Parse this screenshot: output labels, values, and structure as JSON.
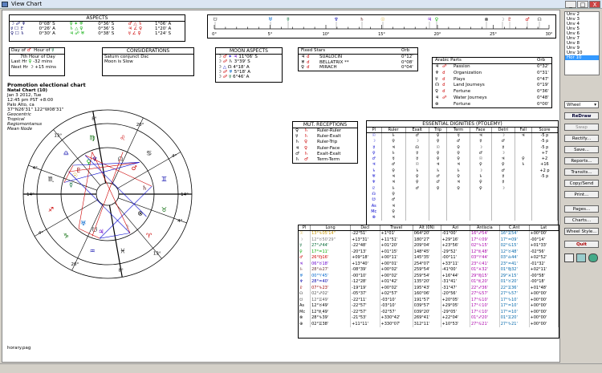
{
  "window": {
    "title": "View Chart",
    "min": "_",
    "max": "□",
    "close": "X"
  },
  "aspects": {
    "title": "ASPECTS",
    "rows": [
      [
        "☽ ☍ ♆",
        "0°08' S",
        "♀ ✶ ♅",
        "0°36' S",
        "♂ △ ♄",
        "1°06' A"
      ],
      [
        "☿ ☐ ♇",
        "0°26' A",
        "♄ △ ♀",
        "0°36' S",
        "♃ ∠ ♀",
        "1°20' A"
      ],
      [
        "♀ ☐ ♄",
        "0°30' A",
        "♃ ☍ ♅",
        "0°38' S",
        "☿ ∠ ♀",
        "1°24' S"
      ]
    ]
  },
  "day_hour": {
    "day_label": "Day of",
    "day_glyph": "♂",
    "hour_label": "Hour of",
    "hour_glyph": "☿",
    "line2": "7th Hour of Day",
    "last_label": "Last Hr",
    "last_glyph": "♀",
    "last_val": "-32 mins",
    "next_label": "Next Hr",
    "next_glyph": "☽",
    "next_val": "+15 mins"
  },
  "considerations": {
    "title": "CONSIDERATIONS",
    "lines": [
      "Saturn conjunct Dsc",
      "Moon is Slow"
    ]
  },
  "moon_aspects": {
    "title": "MOON ASPECTS",
    "rows": [
      [
        "☽",
        "♂",
        "✶",
        "♃",
        "11°06' S"
      ],
      [
        "☽",
        "☍",
        "♄",
        "3°39' S"
      ],
      [
        "☽",
        "△",
        "☊",
        "4°18' A"
      ],
      [
        "☽",
        "☍",
        "♅",
        "5°18' A"
      ],
      [
        "☽",
        "☍",
        "☿",
        "6°46' A"
      ]
    ]
  },
  "fixed_stars": {
    "title": "Fixed Stars",
    "orb": "Orb",
    "rows": [
      [
        "♃",
        "☌",
        "SUALOCIN",
        "0°12'"
      ],
      [
        "♅",
        "☌",
        "BELLATRIX **",
        "0°08'"
      ],
      [
        "♀",
        "☌",
        "MIRACH",
        "0°04'"
      ]
    ]
  },
  "arabic_parts": {
    "title": "Arabic Parts",
    "orb": "Orb",
    "rows": [
      [
        "♃",
        "☍",
        "Passion",
        "0°32'"
      ],
      [
        "♆",
        "☌",
        "Organization",
        "0°31'"
      ],
      [
        "☿",
        "☌",
        "Plays",
        "0°47'"
      ],
      [
        "☊",
        "☌",
        "Land Journeys",
        "0°19'"
      ],
      [
        "♀",
        "☌",
        "Fortune",
        "0°36'"
      ],
      [
        "♃",
        "☍",
        "Water Journeys",
        "0°48'"
      ],
      [
        "⊗",
        "",
        "Fortune",
        "0°00'"
      ]
    ]
  },
  "chart_info": {
    "title": "Promotion electional chart",
    "name": "Natal Chart (10)",
    "date": "Jan 3 2012, Tue",
    "time": "12:45 pm  PST +8:00",
    "place": "Palo Alto, ca",
    "coords": "37°N26'31\" 122°W08'31\"",
    "z1": "Geocentric",
    "z2": "Tropical",
    "z3": "Regiomontanus",
    "z4": "Mean Node",
    "file": "horary.pag"
  },
  "wheel": {
    "cusps": [
      "14°",
      "4°",
      "20°",
      "8°",
      "13°",
      "4°",
      "14°",
      "4°",
      "20°",
      "8°",
      "13°",
      "4°"
    ],
    "signs": [
      "♐",
      "♑",
      "♒",
      "♓",
      "♈",
      "♉",
      "♊",
      "♋",
      "♌",
      "♍",
      "♎",
      "♏"
    ]
  },
  "receptions": {
    "title": "MUT. RECEPTIONS",
    "rows": [
      [
        "♀",
        "♄",
        "Ruler-Ruler"
      ],
      [
        "☿",
        "♄",
        "Ruler-Exalt"
      ],
      [
        "♄",
        "♀",
        "Ruler-Trip"
      ],
      [
        "♃",
        "♀",
        "Ruler-Face"
      ],
      [
        "♂",
        "♄",
        "Exalt-Exalt"
      ],
      [
        "♄",
        "♂",
        "Term-Term"
      ]
    ]
  },
  "dignities": {
    "title": "ESSENTIAL DIGNITIES (PTOLEMY)",
    "headers": [
      "Pl",
      "Ruler",
      "Exalt",
      "Trip",
      "Term",
      "Face",
      "Detri",
      "Fall",
      "Score"
    ],
    "rows": [
      [
        "☉",
        "♄",
        "♂",
        "♀",
        "☿",
        "♃",
        "☽",
        "♃",
        "-5 p"
      ],
      [
        "☽",
        "♀",
        "☽",
        "♀",
        "♂",
        "☿",
        "♂",
        "",
        "-5 p"
      ],
      [
        "☿",
        "♃",
        "☊",
        "☉",
        "♀",
        "☽",
        "☿",
        "",
        "-5 p"
      ],
      [
        "♀",
        "♄",
        "☿",
        "♀",
        "♀",
        "♂",
        "☽",
        "",
        "+7"
      ],
      [
        "♂",
        "☿",
        "☿",
        "♀",
        "♀",
        "☉",
        "♃",
        "♀",
        "+2"
      ],
      [
        "♃",
        "♂",
        "☉",
        "♃",
        "♃",
        "♀",
        "♀",
        "♄",
        "+16"
      ],
      [
        "♄",
        "♀",
        "♄",
        "♄",
        "♄",
        "☽",
        "♂",
        "",
        "+2 p"
      ],
      [
        "♅",
        "♃",
        "♀",
        "♂",
        "♀",
        "♄",
        "☿",
        "",
        "-5 p"
      ],
      [
        "♆",
        "♃",
        "♀",
        "♂",
        "♃",
        "♀",
        "☿",
        "",
        ""
      ],
      [
        "♇",
        "♄",
        "♂",
        "♀",
        "♀",
        "♀",
        "☽",
        "",
        ""
      ],
      [
        "☊",
        "♀",
        "",
        "",
        "",
        "",
        "",
        "",
        ""
      ],
      [
        "☋",
        "♂",
        "",
        "",
        "",
        "",
        "",
        "",
        ""
      ],
      [
        "As",
        "♃",
        "",
        "",
        "",
        "",
        "",
        "",
        ""
      ],
      [
        "Mc",
        "♀",
        "",
        "",
        "",
        "",
        "",
        "",
        ""
      ],
      [
        "⊗",
        "♃",
        "",
        "",
        "",
        "",
        "",
        "",
        ""
      ]
    ]
  },
  "planets": {
    "headers": [
      "Pl",
      "Long",
      "Decl",
      "Travel",
      "Alt (0N)",
      "Azi",
      "Antiscia",
      "C.Ant",
      "Lat"
    ],
    "rows": [
      [
        "☉",
        "13°♑05'14\"",
        "-22°51'",
        "+1°01'",
        "064°20'",
        "-01°00'",
        "16°♐54'",
        "16°♊54'",
        "+00°00'"
      ],
      [
        "☽",
        "12°♉50'29\"",
        "+13°31'",
        "+11°51'",
        "180°27'",
        "+29°16'",
        "17°♌09'",
        "17°♒09'",
        "-00°14'"
      ],
      [
        "☿",
        "27°♐44'",
        "-22°48'",
        "+01°20'",
        "209°04'",
        "+23°56'",
        "02°♑15'",
        "02°♋15'",
        "+01°33'"
      ],
      [
        "♀",
        "17°♒11'",
        "-20°13'",
        "+01°15'",
        "148°45'",
        "-29°52'",
        "12°♏48'",
        "12°♉48'",
        "-02°56'"
      ],
      [
        "♂",
        "26°♍16'",
        "+09°18'",
        "+00°11'",
        "145°35'",
        "-00°11'",
        "03°♈44'",
        "03°♎44'",
        "+02°52'"
      ],
      [
        "♃",
        "06°♉18'",
        "+13°40'",
        "+00°01'",
        "254°07'",
        "+33°11'",
        "23°♌41'",
        "23°♒41'",
        "-01°32'"
      ],
      [
        "♄",
        "28°♎27'",
        "-08°39'",
        "+00°02'",
        "259°54'",
        "-41°00'",
        "01°♓32'",
        "01°♍32'",
        "+02°11'"
      ],
      [
        "♅",
        "00°♈45'",
        "-00°10'",
        "+00°02'",
        "259°54'",
        "+16°44'",
        "29°♍15'",
        "29°♓15'",
        "-00°58'"
      ],
      [
        "♆",
        "28°♒40'",
        "-12°28'",
        "+01°42'",
        "135°20'",
        "-31°41'",
        "01°♏20'",
        "01°♉20'",
        "-00°18'"
      ],
      [
        "♇",
        "07°♑23'",
        "-19°19'",
        "+00°02'",
        "195°43'",
        "-31°47'",
        "22°♐36'",
        "22°♊36'",
        "+01°48'"
      ],
      [
        "☊",
        "02°♐02'",
        "-05°37'",
        "+02°57'",
        "160°06'",
        "-20°56'",
        "27°♋57'",
        "27°♑57'",
        "+00°00'"
      ],
      [
        "☋",
        "12°♊49'",
        "-22°11'",
        "-03°10'",
        "191°57'",
        "+20°05'",
        "17°♋10'",
        "17°♑10'",
        "+00°00'"
      ],
      [
        "As",
        "12°♉49'",
        "-22°57'",
        "-03°10'",
        "039°57'",
        "+29°05'",
        "17°♌10'",
        "17°♒10'",
        "+00°00'"
      ],
      [
        "Mc",
        "12°♏49'",
        "-22°57'",
        "-02°57'",
        "039°20'",
        "-29°05'",
        "17°♌10'",
        "17°♒10'",
        "+00°00'"
      ],
      [
        "⊗",
        "28°♑39'",
        "-21°53'",
        "+330°42'",
        "269°41'",
        "+22°04'",
        "01°♐20'",
        "01°♊20'",
        "+00°00'"
      ],
      [
        "⊕",
        "02°♊38'",
        "+11°11'",
        "+330°07'",
        "312°11'",
        "+10°53'",
        "27°♋21'",
        "27°♑21'",
        "+00°00'"
      ]
    ]
  },
  "right": {
    "houses": [
      "Unv 2",
      "Unv 3",
      "Unv 4",
      "Unv 5",
      "Unv 6",
      "Unv 7",
      "Unv 8",
      "Unv 9",
      "Unv 10",
      "Hor 10"
    ],
    "wheel_select": "Wheel",
    "redraw": "ReDraw",
    "swap": "Swap",
    "rectify": "Rectify...",
    "save": "Save...",
    "reports": "Reports...",
    "transits": "Transits...",
    "copy_send": "Copy/Send",
    "print": "Print...",
    "pages": "Pages...",
    "charts": "Charts...",
    "wheel_style": "Wheel Style...",
    "quit": "Quit"
  },
  "ruler": {
    "ticks": [
      "0°",
      "5°",
      "10°",
      "15°",
      "20°",
      "25°",
      "30°"
    ]
  },
  "colors": {
    "accent": "#3399ff",
    "aspect_red": "#d00000",
    "aspect_blue": "#0000cc"
  }
}
